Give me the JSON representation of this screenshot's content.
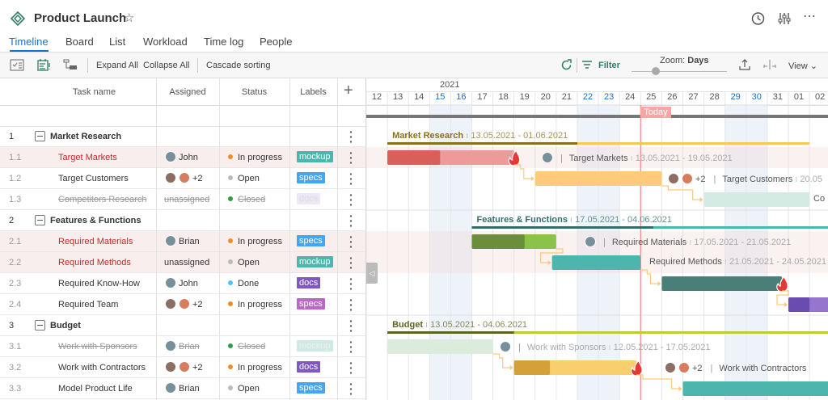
{
  "app": {
    "title": "Product Launch",
    "icons": [
      "project-diamond-icon",
      "star-icon",
      "history-icon",
      "settings-sliders-icon",
      "more-icon"
    ]
  },
  "tabs": [
    {
      "label": "Timeline",
      "active": true
    },
    {
      "label": "Board"
    },
    {
      "label": "List"
    },
    {
      "label": "Workload"
    },
    {
      "label": "Time log"
    },
    {
      "label": "People"
    }
  ],
  "toolbar": {
    "expand_all": "Expand All",
    "collapse_all": "Collapse All",
    "cascade": "Cascade sorting",
    "filter": "Filter",
    "zoom_label": "Zoom:",
    "zoom_value": "Days",
    "view": "View",
    "zoom_level": 0.25
  },
  "columns": {
    "task": "Task name",
    "assigned": "Assigned",
    "status": "Status",
    "labels": "Labels"
  },
  "timeline": {
    "year": "2021",
    "days": [
      "12",
      "13",
      "14",
      "15",
      "16",
      "17",
      "18",
      "19",
      "20",
      "21",
      "22",
      "23",
      "24",
      "25",
      "26",
      "27",
      "28",
      "29",
      "30",
      "31",
      "01",
      "02"
    ],
    "weekends": [
      "15",
      "16",
      "22",
      "23",
      "29",
      "30"
    ],
    "today": "Today"
  },
  "rows": [
    {
      "num": "1",
      "name": "Market Research",
      "group": true
    },
    {
      "num": "1.1",
      "name": "Target Markets",
      "assigned": "John",
      "status": "In progress",
      "status_color": "#f28c28",
      "label": "mockup",
      "label_color": "#4db6ac",
      "overdue": true
    },
    {
      "num": "1.2",
      "name": "Target Customers",
      "assigned": "+2",
      "status": "Open",
      "status_color": "#bbbbbb",
      "label": "specs",
      "label_color": "#42a5f5"
    },
    {
      "num": "1.3",
      "name": "Competitors Research",
      "assigned": "unassigned",
      "status": "Closed",
      "status_color": "#2e9e44",
      "label": "docs",
      "label_color": "#ede7f6",
      "closed": true
    },
    {
      "num": "2",
      "name": "Features & Functions",
      "group": true
    },
    {
      "num": "2.1",
      "name": "Required Materials",
      "assigned": "Brian",
      "status": "In progress",
      "status_color": "#f28c28",
      "label": "specs",
      "label_color": "#42a5f5",
      "overdue": true
    },
    {
      "num": "2.2",
      "name": "Required Methods",
      "assigned": "unassigned",
      "status": "Open",
      "status_color": "#bbbbbb",
      "label": "mockup",
      "label_color": "#4db6ac",
      "overdue": true
    },
    {
      "num": "2.3",
      "name": "Required Know-How",
      "assigned": "John",
      "status": "Done",
      "status_color": "#4fc3f7",
      "label": "docs",
      "label_color": "#7e57c2"
    },
    {
      "num": "2.4",
      "name": "Required Team",
      "assigned": "+2",
      "status": "In progress",
      "status_color": "#f28c28",
      "label": "specs",
      "label_color": "#ba68c8"
    },
    {
      "num": "3",
      "name": "Budget",
      "group": true
    },
    {
      "num": "3.1",
      "name": "Work with Sponsors",
      "assigned": "Brian",
      "status": "Closed",
      "status_color": "#2e9e44",
      "label": "mockup",
      "label_color": "#cfe9e4",
      "closed": true
    },
    {
      "num": "3.2",
      "name": "Work with Contractors",
      "assigned": "+2",
      "status": "In progress",
      "status_color": "#f28c28",
      "label": "docs",
      "label_color": "#7e57c2"
    },
    {
      "num": "3.3",
      "name": "Model Product Life",
      "assigned": "Brian",
      "status": "Open",
      "status_color": "#bbbbbb",
      "label": "specs",
      "label_color": "#42a5f5"
    }
  ],
  "gantt": {
    "groups": [
      {
        "name": "Market Research",
        "dates": "13.05.2021 - 01.06.2021",
        "color": "#8d6e1e"
      },
      {
        "name": "Features & Functions",
        "dates": "17.05.2021 - 04.06.2021",
        "color": "#2f6f6a"
      },
      {
        "name": "Budget",
        "dates": "13.05.2021 - 04.06.2021",
        "color": "#5e6420"
      }
    ],
    "tasks": [
      {
        "name": "Target Markets",
        "dates": "13.05.2021 - 19.05.2021"
      },
      {
        "name": "Target Customers",
        "dates": "20.05",
        "extra": "+2"
      },
      {
        "name": "Co"
      },
      {
        "name": "Required Materials",
        "dates": "17.05.2021 - 21.05.2021"
      },
      {
        "name": "Required Methods",
        "dates": "21.05.2021 - 24.05.2021"
      },
      {
        "name": "Work with Sponsors",
        "dates": "12.05.2021 - 17.05.2021"
      },
      {
        "name": "Work with Contractors",
        "extra": "+2"
      }
    ]
  }
}
